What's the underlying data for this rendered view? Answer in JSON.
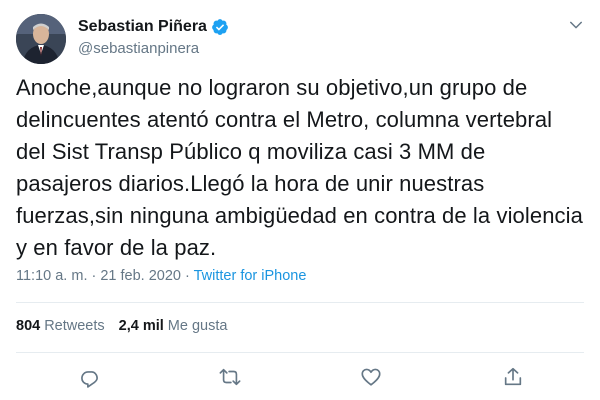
{
  "user": {
    "display_name": "Sebastian Piñera",
    "handle": "@sebastianpinera",
    "verified": true
  },
  "tweet": {
    "text": "Anoche,aunque no lograron su objetivo,un grupo de delincuentes atentó contra el Metro, columna vertebral del Sist Transp Público q moviliza casi 3 MM de pasajeros diarios.Llegó la hora de unir nuestras fuerzas,sin ninguna ambigüedad en contra de la violencia y en favor de la paz.",
    "timestamp": "11:10 a. m. · 21 feb. 2020",
    "separator": " · ",
    "source": "Twitter for iPhone"
  },
  "stats": {
    "retweets_count": "804",
    "retweets_label": "Retweets",
    "likes_count": "2,4 mil",
    "likes_label": "Me gusta"
  },
  "icons": {
    "verified": "verified-badge-icon",
    "menu": "chevron-down-icon",
    "reply": "reply-icon",
    "retweet": "retweet-icon",
    "like": "heart-icon",
    "share": "share-icon"
  },
  "colors": {
    "link": "#1b95e0",
    "secondary_text": "#657786",
    "primary_text": "#14171a",
    "verified": "#1da1f2"
  }
}
